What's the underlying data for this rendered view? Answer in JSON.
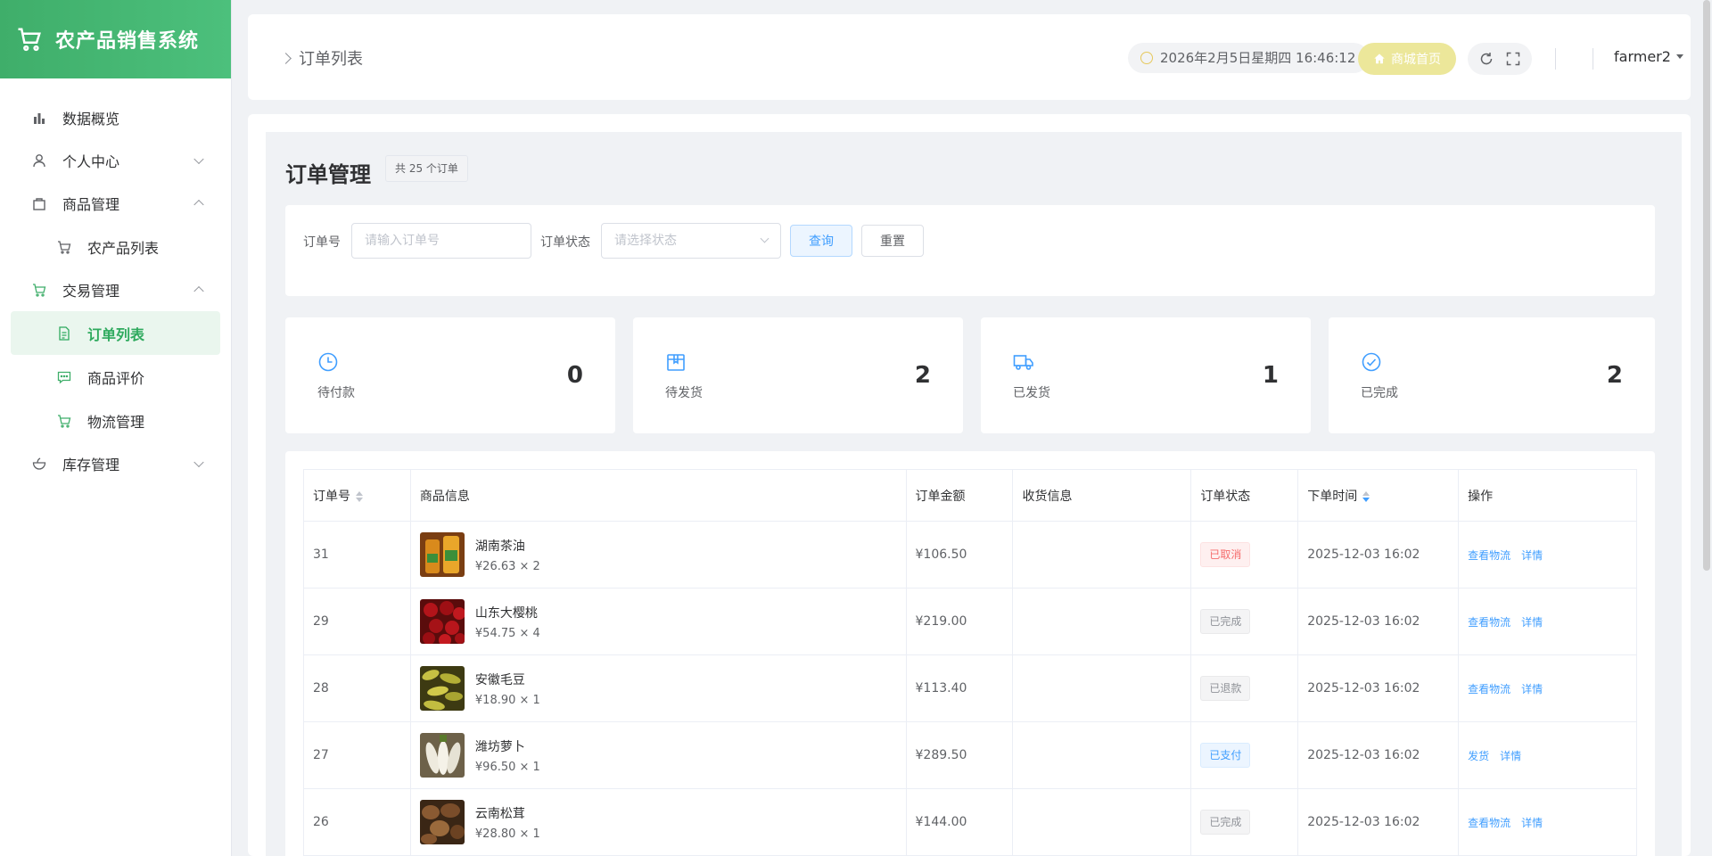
{
  "app": {
    "title": "农产品销售系统"
  },
  "sidebar": {
    "items": [
      {
        "label": "数据概览",
        "icon": "bar-chart-icon"
      },
      {
        "label": "个人中心",
        "icon": "user-icon"
      },
      {
        "label": "商品管理",
        "icon": "shop-bag-icon"
      },
      {
        "label": "农产品列表",
        "icon": "cart-icon"
      },
      {
        "label": "交易管理",
        "icon": "cart-icon"
      },
      {
        "label": "订单列表",
        "icon": "document-icon"
      },
      {
        "label": "商品评价",
        "icon": "comment-icon"
      },
      {
        "label": "物流管理",
        "icon": "cart-icon"
      },
      {
        "label": "库存管理",
        "icon": "bowl-icon"
      }
    ]
  },
  "header": {
    "breadcrumb": "订单列表",
    "datetime": "2026年2月5日星期四 16:46:12",
    "home_label": "商城首页",
    "username": "farmer2"
  },
  "page": {
    "title": "订单管理",
    "count_badge": "共 25 个订单"
  },
  "filter": {
    "order_no_label": "订单号",
    "order_no_placeholder": "请输入订单号",
    "status_label": "订单状态",
    "status_placeholder": "请选择状态",
    "query_label": "查询",
    "reset_label": "重置"
  },
  "stats": [
    {
      "label": "待付款",
      "value": "0"
    },
    {
      "label": "待发货",
      "value": "2"
    },
    {
      "label": "已发货",
      "value": "1"
    },
    {
      "label": "已完成",
      "value": "2"
    }
  ],
  "table": {
    "columns": [
      "订单号",
      "商品信息",
      "订单金额",
      "收货信息",
      "订单状态",
      "下单时间",
      "操作"
    ],
    "rows": [
      {
        "id": "31",
        "name": "湖南茶油",
        "price_qty": "¥26.63 × 2",
        "amount": "¥106.50",
        "address": "",
        "status": "已取消",
        "time": "2025-12-03 16:02",
        "op1": "查看物流",
        "op2": "详情"
      },
      {
        "id": "29",
        "name": "山东大樱桃",
        "price_qty": "¥54.75 × 4",
        "amount": "¥219.00",
        "address": "",
        "status": "已完成",
        "time": "2025-12-03 16:02",
        "op1": "查看物流",
        "op2": "详情"
      },
      {
        "id": "28",
        "name": "安徽毛豆",
        "price_qty": "¥18.90 × 1",
        "amount": "¥113.40",
        "address": "",
        "status": "已退款",
        "time": "2025-12-03 16:02",
        "op1": "查看物流",
        "op2": "详情"
      },
      {
        "id": "27",
        "name": "潍坊萝卜",
        "price_qty": "¥96.50 × 1",
        "amount": "¥289.50",
        "address": "",
        "status": "已支付",
        "time": "2025-12-03 16:02",
        "op1": "发货",
        "op2": "详情"
      },
      {
        "id": "26",
        "name": "云南松茸",
        "price_qty": "¥28.80 × 1",
        "amount": "¥144.00",
        "address": "",
        "status": "已完成",
        "time": "2025-12-03 16:02",
        "op1": "查看物流",
        "op2": "详情"
      }
    ]
  },
  "colors": {
    "brand": "#3fae6a",
    "link": "#409eff",
    "stat_icon": "#409eff"
  }
}
